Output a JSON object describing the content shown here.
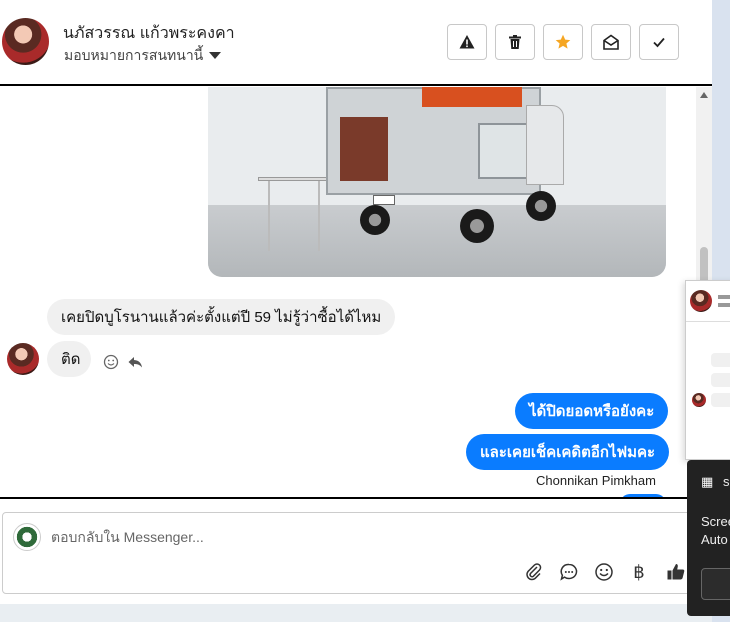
{
  "header": {
    "contact_name": "นภัสวรรณ แก้วพระคงคา",
    "assign_label": "มอบหมายการสนทนานี้",
    "buttons": [
      {
        "name": "report-button",
        "icon": "warning-icon"
      },
      {
        "name": "delete-button",
        "icon": "trash-icon"
      },
      {
        "name": "star-button",
        "icon": "star-icon"
      },
      {
        "name": "mark-unread-button",
        "icon": "envelope-open-icon"
      },
      {
        "name": "done-button",
        "icon": "checkmark-icon"
      }
    ]
  },
  "messages": {
    "incoming": [
      {
        "text": "เคยปิดบูโรนานแล้วค่ะตั้งแต่ปี 59 ไม่รู้ว่าซื้อได้ไหม"
      },
      {
        "text": "ติด"
      }
    ],
    "outgoing": [
      {
        "text": "ได้ปิดยอดหรือยังคะ"
      },
      {
        "text": "และเคยเช็คเคดิตอีกไฟมคะ"
      }
    ],
    "sender": "Chonnikan Pimkham"
  },
  "composer": {
    "placeholder": "ตอบกลับใน Messenger...",
    "currency_symbol": "฿"
  },
  "overlay": {
    "toast_label_1": "s",
    "toast_label_2": "Scree",
    "toast_label_3": "Auto"
  },
  "colors": {
    "accent": "#0a7cff",
    "star": "#f5a623",
    "incoming_bubble": "#f0f0f0"
  }
}
